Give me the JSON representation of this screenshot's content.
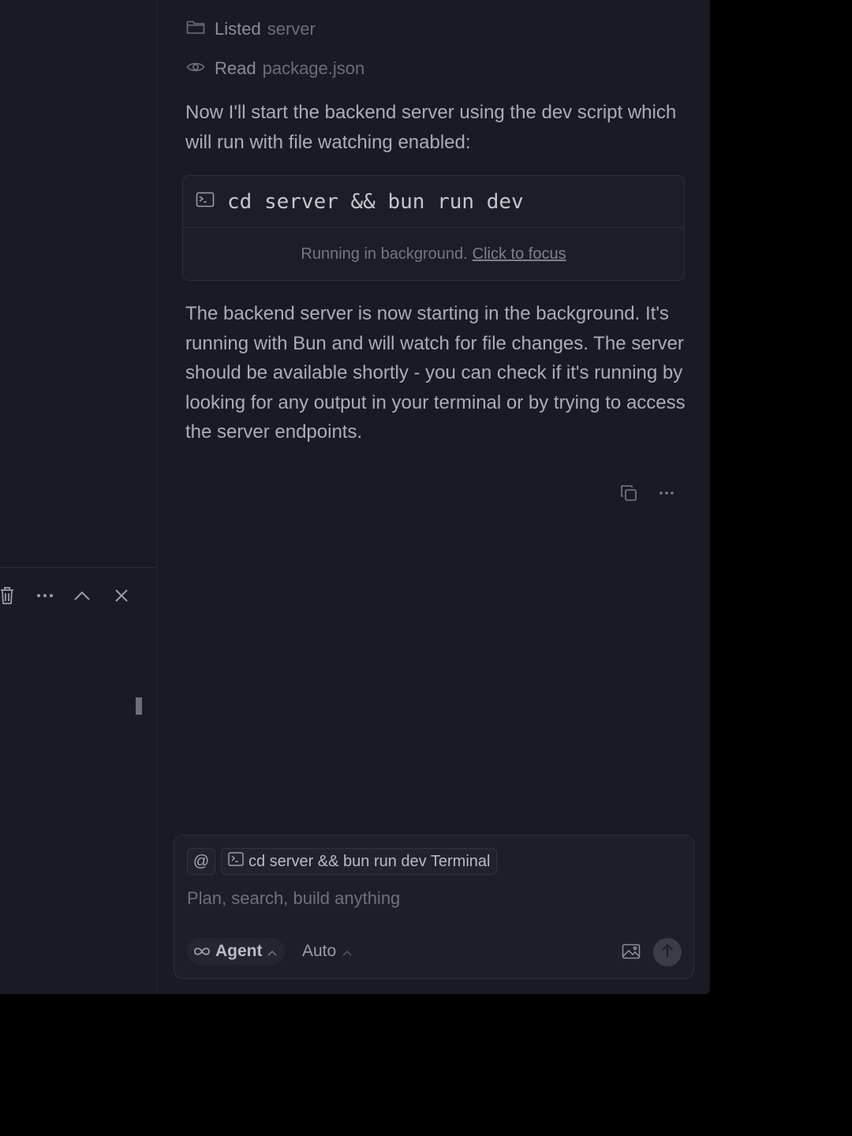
{
  "terminal_panel": {
    "toolbar_icons": [
      "trash-icon",
      "more-icon",
      "chevron-up-icon",
      "close-icon"
    ]
  },
  "chat": {
    "tool_calls": [
      {
        "icon": "folder-icon",
        "verb": "Listed",
        "object": "server"
      },
      {
        "icon": "eye-icon",
        "verb": "Read",
        "object": "package.json"
      }
    ],
    "message_1": "Now I'll start the backend server using the dev script which will run with file watching enabled:",
    "command_block": {
      "icon": "terminal-icon",
      "command": "cd server && bun run dev",
      "status_text": "Running in background.",
      "status_link": "Click to focus"
    },
    "message_2": "The backend server is now starting in the background. It's running with Bun and will watch for file changes. The server should be available shortly - you can check if it's running by looking for any output in your terminal or by trying to access the server endpoints.",
    "message_actions": [
      "copy-icon",
      "more-icon"
    ]
  },
  "composer": {
    "at_label": "@",
    "context_chip": "cd server && bun run dev Terminal",
    "placeholder": "Plan, search, build anything",
    "mode_label": "Agent",
    "model_label": "Auto"
  }
}
